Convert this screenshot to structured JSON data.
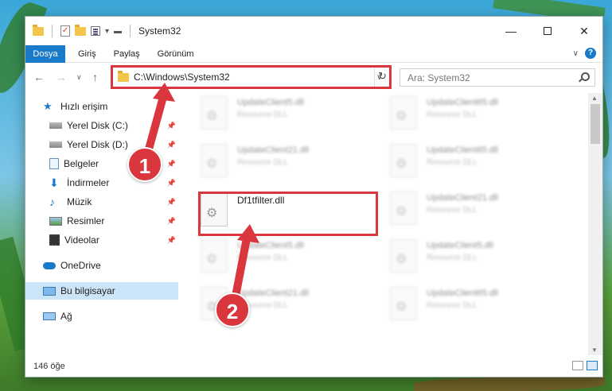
{
  "window": {
    "title": "System32",
    "minimize_icon": "minimize-icon",
    "maximize_icon": "maximize-icon",
    "close_icon": "close-icon"
  },
  "ribbon": {
    "tabs": [
      "Dosya",
      "Giriş",
      "Paylaş",
      "Görünüm"
    ],
    "active_tab": "Dosya"
  },
  "nav": {
    "address": "C:\\Windows\\System32",
    "search_placeholder": "Ara: System32"
  },
  "sidebar": {
    "items": [
      {
        "label": "Hızlı erişim",
        "icon": "star-icon",
        "pinned": false
      },
      {
        "label": "Yerel Disk (C:)",
        "icon": "drive-icon",
        "pinned": true
      },
      {
        "label": "Yerel Disk (D:)",
        "icon": "drive-icon",
        "pinned": true
      },
      {
        "label": "Belgeler",
        "icon": "document-icon",
        "pinned": true
      },
      {
        "label": "İndirmeler",
        "icon": "download-icon",
        "pinned": true
      },
      {
        "label": "Müzik",
        "icon": "music-icon",
        "pinned": true
      },
      {
        "label": "Resimler",
        "icon": "picture-icon",
        "pinned": true
      },
      {
        "label": "Videolar",
        "icon": "video-icon",
        "pinned": true
      },
      {
        "label": "OneDrive",
        "icon": "cloud-icon",
        "pinned": false
      },
      {
        "label": "Bu bilgisayar",
        "icon": "computer-icon",
        "pinned": false,
        "selected": true
      },
      {
        "label": "Ağ",
        "icon": "network-icon",
        "pinned": false
      }
    ]
  },
  "files": [
    {
      "name": "UpdateClient5.dll",
      "type": "Resource DLL"
    },
    {
      "name": "UpdateClient65.dll",
      "type": "Resource DLL"
    },
    {
      "name": "UpdateClient21.dll",
      "type": "Resource DLL"
    },
    {
      "name": "UpdateClient65.dll",
      "type": "Resource DLL"
    },
    {
      "name": "Df1tfilter.dll",
      "type": ""
    },
    {
      "name": "UpdateClient21.dll",
      "type": "Resource DLL"
    },
    {
      "name": "UpdateClient5.dll",
      "type": "Resource DLL"
    },
    {
      "name": "UpdateClient5.dll",
      "type": "Resource DLL"
    },
    {
      "name": "UpdateClient21.dll",
      "type": "Resource DLL"
    },
    {
      "name": "UpdateClient65.dll",
      "type": "Resource DLL"
    }
  ],
  "status": {
    "item_count": "146 öğe"
  },
  "annotations": {
    "step1": "1",
    "step2": "2",
    "color": "#d9363e"
  }
}
